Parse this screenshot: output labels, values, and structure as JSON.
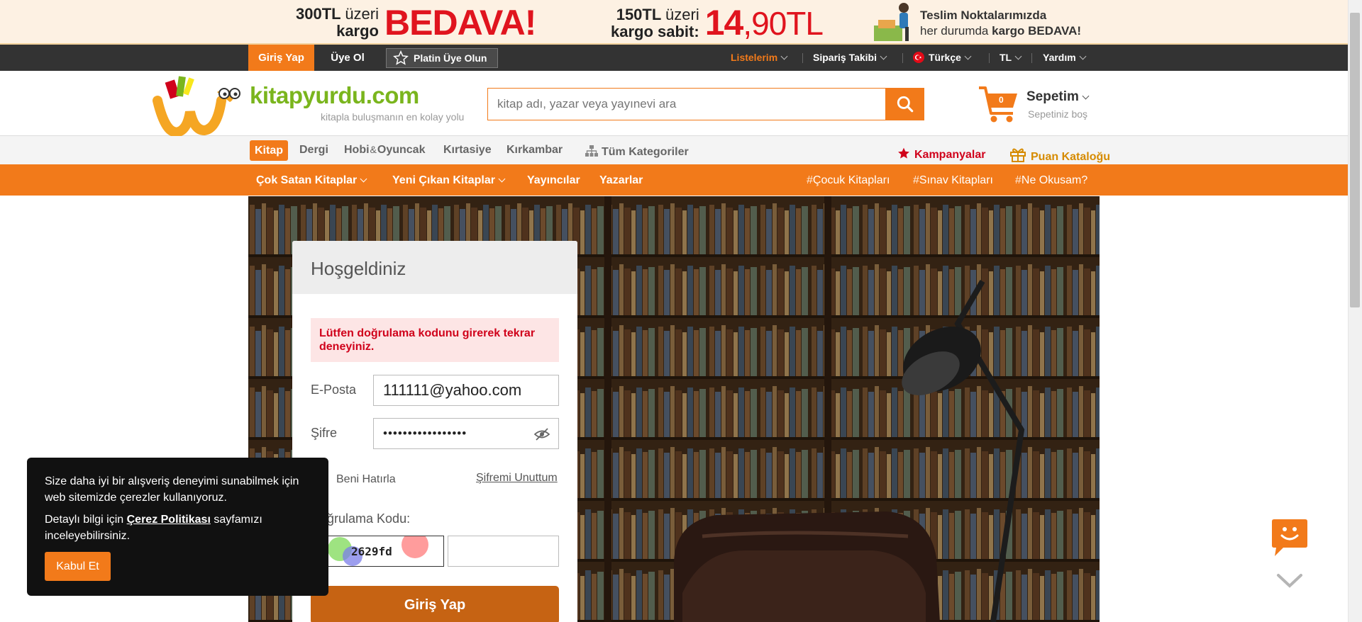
{
  "promo": {
    "free_shipping": {
      "amount": "300TL",
      "amount_suffix": "üzeri",
      "line2": "kargo",
      "big": "BEDAVA!"
    },
    "fixed_shipping": {
      "amount": "150TL",
      "amount_suffix": "üzeri",
      "line2": "kargo sabit:",
      "big_int": "14",
      "big_dec": ",90TL"
    },
    "pickup": {
      "line1": "Teslim Noktalarımızda",
      "line2_prefix": "her durumda",
      "line2_bold": "kargo BEDAVA!"
    }
  },
  "topbar": {
    "login": "Giriş Yap",
    "signup": "Üye Ol",
    "platin": "Platin Üye Olun",
    "lists": "Listelerim",
    "order_tracking": "Sipariş Takibi",
    "language": "Türkçe",
    "currency": "TL",
    "help": "Yardım"
  },
  "header": {
    "logo_name": "kitapyurdu.com",
    "logo_tagline": "kitapla buluşmanın en kolay yolu",
    "search_placeholder": "kitap adı, yazar veya yayınevi ara",
    "cart_title": "Sepetim",
    "cart_subtitle": "Sepetiniz boş",
    "cart_count": "0"
  },
  "category_nav": {
    "items": [
      "Kitap",
      "Dergi",
      "Hobi",
      "Oyuncak",
      "Kırtasiye",
      "Kırkambar"
    ],
    "hobi_amp": "&",
    "all_categories": "Tüm Kategoriler",
    "campaigns": "Kampanyalar",
    "points_catalog": "Puan Kataloğu"
  },
  "orange_menu": {
    "items": [
      "Çok Satan Kitaplar",
      "Yeni Çıkan Kitaplar",
      "Yayıncılar",
      "Yazarlar"
    ],
    "tags": [
      "Çocuk Kitapları",
      "Sınav Kitapları",
      "Ne Okusam?"
    ]
  },
  "login_form": {
    "title": "Hoşgeldiniz",
    "error": "Lütfen doğrulama kodunu girerek tekrar deneyiniz.",
    "email_label": "E-Posta",
    "email_value": "111111@yahoo.com",
    "password_label": "Şifre",
    "password_value": "•••••••••••••••••",
    "remember_me": "Beni Hatırla",
    "forgot_password": "Şifremi Unuttum",
    "captcha_label": "Doğrulama Kodu:",
    "captcha_code": "2629fd",
    "captcha_input_value": "",
    "submit": "Giriş Yap"
  },
  "cookie": {
    "line1": "Size daha iyi bir alışveriş deneyimi sunabilmek için web sitemizde çerezler kullanıyoruz.",
    "line2_prefix": "Detaylı bilgi için",
    "line2_link": "Çerez Politikası",
    "line2_suffix": "sayfamızı inceleyebilirsiniz.",
    "accept": "Kabul Et"
  },
  "colors": {
    "brand_orange": "#f27a1a",
    "brand_green": "#7ab51d",
    "promo_red": "#e0141e",
    "dark_bar": "#333333"
  }
}
